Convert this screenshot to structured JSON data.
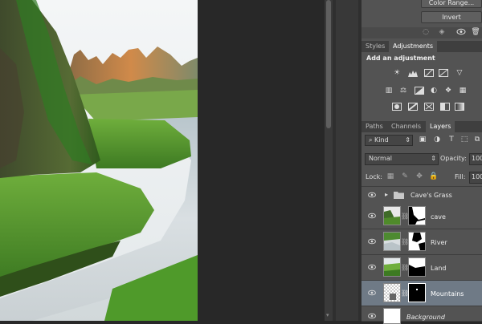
{
  "buttons": {
    "color_range": "Color Range...",
    "invert": "Invert"
  },
  "adjustments_panel": {
    "tabs": [
      {
        "label": "Styles"
      },
      {
        "label": "Adjustments"
      }
    ],
    "heading": "Add an adjustment",
    "icons": [
      "brightness-contrast-icon",
      "levels-icon",
      "curves-icon",
      "exposure-icon",
      "vibrance-icon",
      "hue-saturation-icon",
      "color-balance-icon",
      "black-white-icon",
      "photo-filter-icon",
      "channel-mixer-icon",
      "color-lookup-icon",
      "invert-icon",
      "posterize-icon",
      "threshold-icon",
      "selective-color-icon",
      "gradient-map-icon"
    ]
  },
  "layers_panel": {
    "tabs": [
      {
        "label": "Paths"
      },
      {
        "label": "Channels"
      },
      {
        "label": "Layers"
      }
    ],
    "filter_kind": "Kind",
    "blend_mode": "Normal",
    "opacity_label": "Opacity:",
    "opacity_value": "100",
    "lock_label": "Lock:",
    "fill_label": "Fill:",
    "fill_value": "100",
    "group_name": "Cave's Grass",
    "layers": [
      {
        "name": "cave"
      },
      {
        "name": "River"
      },
      {
        "name": "Land"
      },
      {
        "name": "Mountains"
      },
      {
        "name": "Background"
      }
    ]
  },
  "colors": {
    "panel_bg": "#535353",
    "selected_layer": "#6f7a86",
    "pasteboard": "#282828"
  }
}
